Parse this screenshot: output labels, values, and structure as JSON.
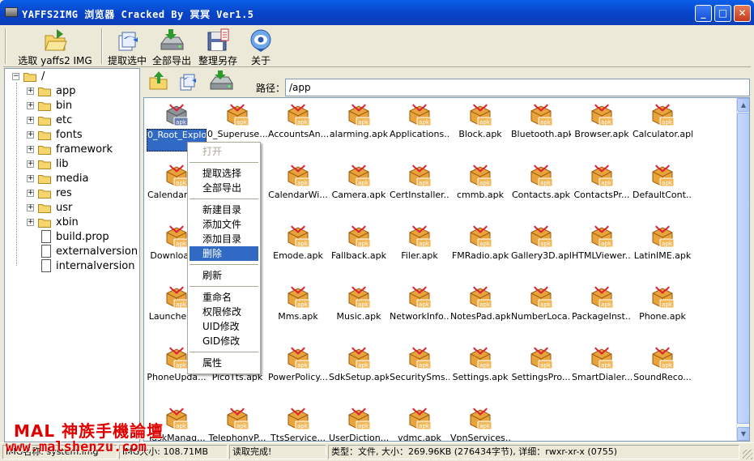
{
  "window": {
    "title": "YAFFS2IMG 浏览器 Cracked By 冥冥 Ver1.5"
  },
  "window_controls": {
    "minimize": "_",
    "maximize": "□",
    "close": "✕"
  },
  "toolbar": {
    "select_img": "选取 yaffs2 IMG",
    "extract_selected": "提取选中",
    "export_all": "全部导出",
    "save_as": "整理另存",
    "about": "关于"
  },
  "tree": {
    "root": "/",
    "folders": [
      "app",
      "bin",
      "etc",
      "fonts",
      "framework",
      "lib",
      "media",
      "res",
      "usr",
      "xbin"
    ],
    "files": [
      "build.prop",
      "externalversion",
      "internalversion"
    ]
  },
  "path": {
    "label": "路径：",
    "value": "/app"
  },
  "files": [
    "0_Root_Explorer_2.16.apk",
    "0_Superuse...",
    "AccountsAn...",
    "alarming.apk",
    "Applications....",
    "Block.apk",
    "Bluetooth.apk",
    "Browser.apk",
    "Calculator.apk",
    "Calendar.apk",
    "",
    "CalendarWi...",
    "Camera.apk",
    "CertInstaller....",
    "cmmb.apk",
    "Contacts.apk",
    "ContactsPr...",
    "DefaultCont...",
    "Download...",
    "",
    "Emode.apk",
    "Fallback.apk",
    "Filer.apk",
    "FMRadio.apk",
    "Gallery3D.apk",
    "HTMLViewer...",
    "LatinIME.apk",
    "Launcher2...",
    "",
    "Mms.apk",
    "Music.apk",
    "NetworkInfo...",
    "NotesPad.apk",
    "NumberLoca...",
    "PackageInst...",
    "Phone.apk",
    "PhoneUpda...",
    "PicoTts.apk",
    "PowerPolicy....",
    "SdkSetup.apk",
    "SecuritySms...",
    "Settings.apk",
    "SettingsPro...",
    "SmartDialer....",
    "SoundReco...",
    "TaskManag...",
    "TelephonyP...",
    "TtsService...",
    "UserDiction...",
    "vdmc.apk",
    "VpnServices..."
  ],
  "context_menu": {
    "open": "打开",
    "extract_selection": "提取选择",
    "export_all": "全部导出",
    "new_folder": "新建目录",
    "add_file": "添加文件",
    "add_folder": "添加目录",
    "delete": "删除",
    "refresh": "刷新",
    "rename": "重命名",
    "permissions": "权限修改",
    "uid": "UID修改",
    "gid": "GID修改",
    "properties": "属性"
  },
  "status": {
    "img_name": "IMG名称: system.img",
    "img_size": "IMG大小: 108.71MB",
    "read_status": "读取完成!",
    "details": "类型：文件, 大小：269.96KB (276434字节), 详细：rwxr-xr-x (0755)"
  },
  "watermark": {
    "line1": "MAL 神族手機論壇",
    "line2": "www.malshenzu.com"
  },
  "colors": {
    "selection": "#316ac5",
    "titlebar": "#0843c7",
    "watermark": "#e00000"
  }
}
